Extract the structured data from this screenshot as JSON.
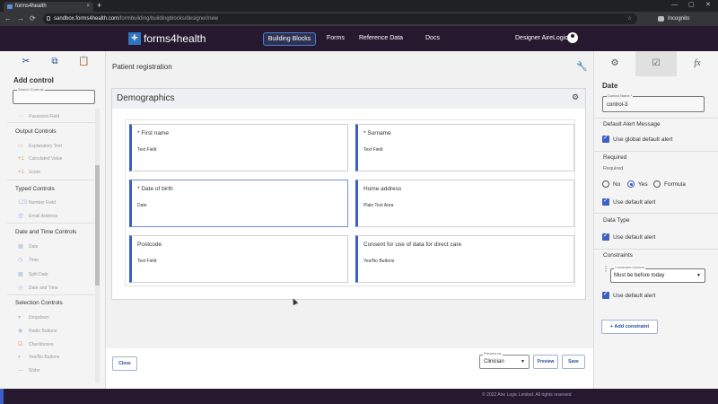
{
  "browser": {
    "tab_title": "forms4health",
    "url_host": "sandbox.forms4health.com",
    "url_path": "/formbuilding/buildingblocks/designer/new",
    "incognito_label": "Incognito",
    "new_tab": "+",
    "tab_close": "×",
    "minimize": "—",
    "maximize": "▢",
    "close": "✕",
    "back": "←",
    "forward": "→",
    "reload": "⟳",
    "star": "☆"
  },
  "header": {
    "logo_text": "forms4health",
    "nav": [
      {
        "label": "Building Blocks"
      },
      {
        "label": "Forms"
      },
      {
        "label": "Reference Data"
      },
      {
        "label": "Docs"
      }
    ],
    "user_name": "Designer AireLogic"
  },
  "left_panel": {
    "tool_icons": [
      "✂",
      "⧉",
      "📋"
    ],
    "title": "Add control",
    "search_label": "Search Controls",
    "partial_item": {
      "label": "Password Field",
      "icon": "⋯"
    },
    "categories": [
      {
        "label": "Output Controls",
        "items": [
          {
            "label": "Explanatory Text",
            "icon": "▭"
          },
          {
            "label": "Calculated Value",
            "icon": "+1"
          },
          {
            "label": "Score",
            "icon": "+1"
          }
        ]
      },
      {
        "label": "Typed Controls",
        "items": [
          {
            "label": "Number Field",
            "icon": "123"
          },
          {
            "label": "Email Address",
            "icon": "@"
          }
        ]
      },
      {
        "label": "Date and Time Controls",
        "items": [
          {
            "label": "Date",
            "icon": "▦"
          },
          {
            "label": "Time",
            "icon": "◷"
          },
          {
            "label": "Split Date",
            "icon": "▦"
          },
          {
            "label": "Date and Time",
            "icon": "◷"
          }
        ]
      },
      {
        "label": "Selection Controls",
        "items": [
          {
            "label": "Dropdown",
            "icon": "▾"
          },
          {
            "label": "Radio Buttons",
            "icon": "◉"
          },
          {
            "label": "Checkboxes",
            "icon": "☑"
          },
          {
            "label": "Yes/No Buttons",
            "icon": "◐"
          },
          {
            "label": "Slider",
            "icon": "—"
          }
        ]
      }
    ]
  },
  "center": {
    "page_title": "Patient registration",
    "section_title": "Demographics",
    "fields": [
      {
        "label": "* First name",
        "type": "Text Field"
      },
      {
        "label": "* Surname",
        "type": "Text Field"
      },
      {
        "label": "* Date of birth",
        "type": "Date"
      },
      {
        "label": "Home address",
        "type": "Plain Text Area"
      },
      {
        "label": "Postcode",
        "type": "Text Field"
      },
      {
        "label": "Consent for use of data for direct care",
        "type": "Yes/No Buttons"
      }
    ],
    "footer": {
      "close_label": "Close",
      "preview_as_label": "Preview as",
      "preview_as_value": "Clinician",
      "preview_label": "Preview",
      "save_label": "Save"
    }
  },
  "right_panel": {
    "tabs": [
      "⚙",
      "☑",
      "fx"
    ],
    "title": "Date",
    "control_name_label": "Control Name *",
    "control_name_value": "control-3",
    "default_alert_heading": "Default Alert Message",
    "use_global_default_alert": "Use global default alert",
    "required_heading": "Required",
    "required_sub": "Required",
    "required_options": [
      {
        "label": "No",
        "selected": false
      },
      {
        "label": "Yes",
        "selected": true
      },
      {
        "label": "Formula",
        "selected": false
      }
    ],
    "required_use_default": "Use default alert",
    "data_type_heading": "Data Type",
    "data_type_use_default": "Use default alert",
    "constraints_heading": "Constraints",
    "constraint_options_label": "Constraint Options",
    "constraint_value": "Must be before today",
    "constraints_use_default": "Use default alert",
    "add_constraint_label": "+ Add constraint"
  },
  "footer": {
    "copyright": "© 2022 Aire Logic Limited. All rights reserved"
  },
  "colors": {
    "header_bg": "#26182e",
    "accent_blue": "#3b5fc4",
    "link_blue": "#2b4c9a"
  }
}
